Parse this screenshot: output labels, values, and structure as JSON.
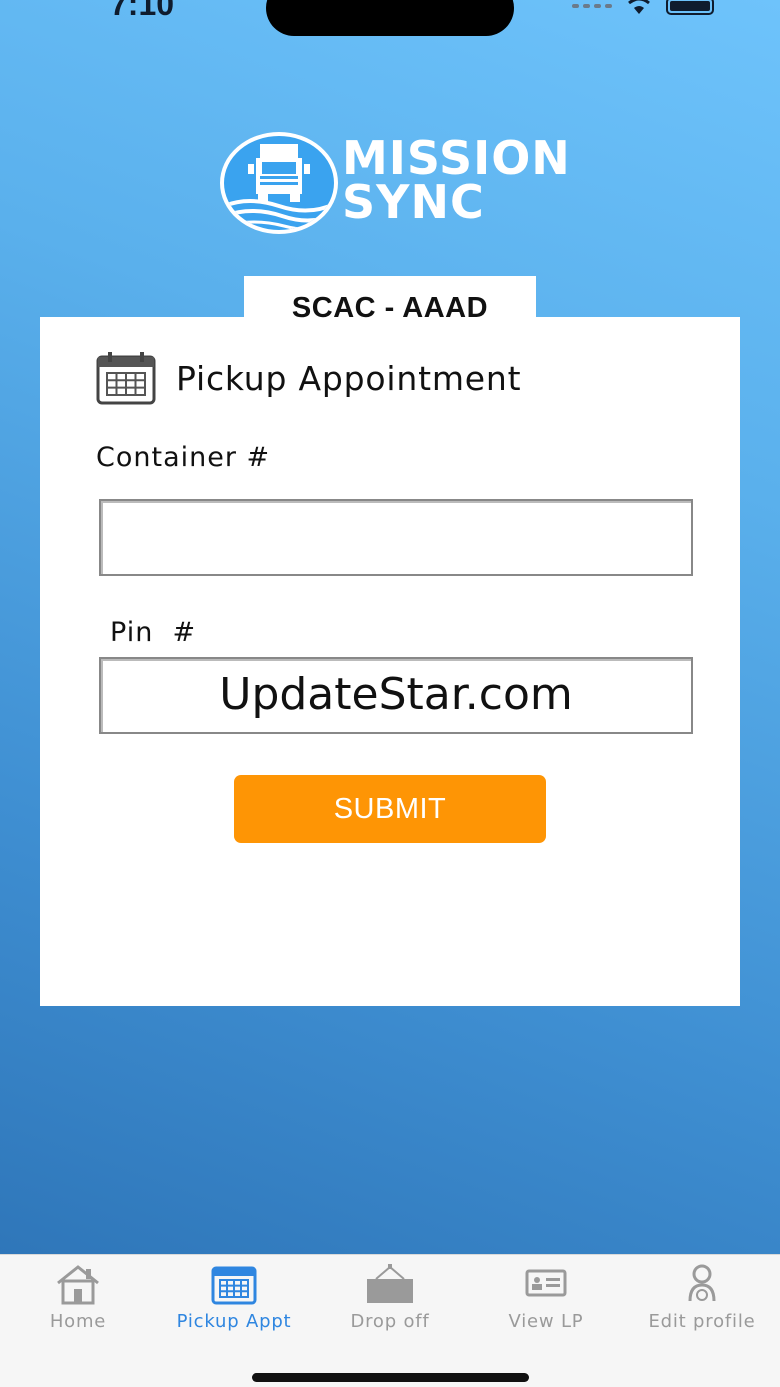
{
  "status_bar": {
    "time": "7:10"
  },
  "logo": {
    "line1": "MISSION",
    "line2": "SYNC"
  },
  "scac_label": "SCAC - AAAD",
  "card": {
    "title": "Pickup Appointment",
    "container_label": "Container #",
    "container_value": "",
    "pin_label": "Pin  #",
    "pin_value": "UpdateStar.com",
    "submit_label": "SUBMIT"
  },
  "tabs": [
    {
      "label": "Home",
      "icon": "home-icon",
      "active": false
    },
    {
      "label": "Pickup Appt",
      "icon": "calendar-icon",
      "active": true
    },
    {
      "label": "Drop off",
      "icon": "container-drop-icon",
      "active": false
    },
    {
      "label": "View LP",
      "icon": "license-plate-icon",
      "active": false
    },
    {
      "label": "Edit profile",
      "icon": "profile-icon",
      "active": false
    }
  ],
  "colors": {
    "accent": "#2f86e0",
    "submit": "#fe9505",
    "background": "#5ab0ec"
  }
}
